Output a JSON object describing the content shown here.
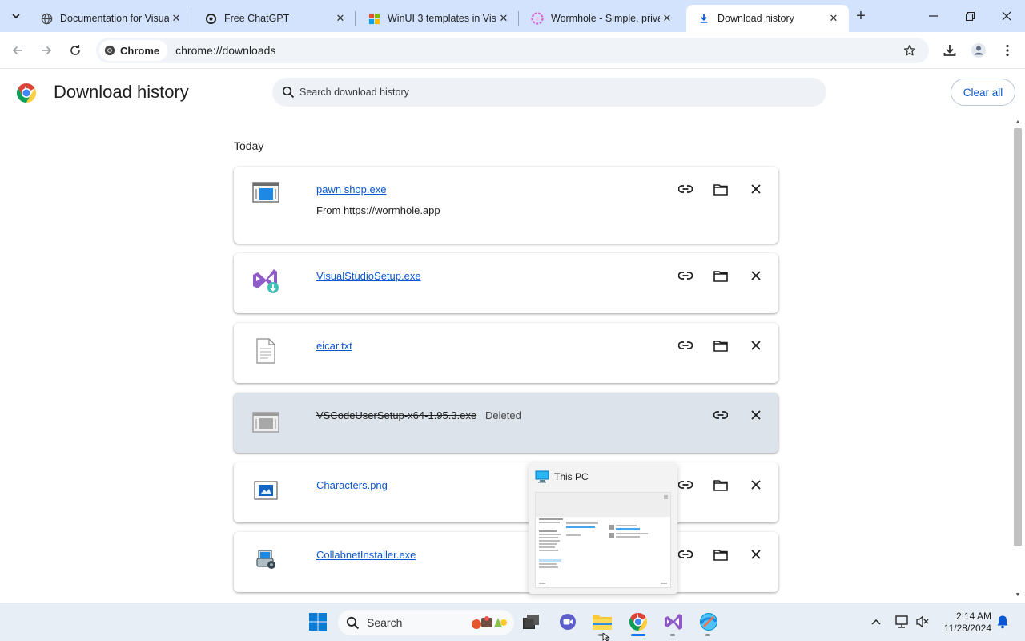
{
  "browser": {
    "tabs": [
      {
        "title": "Documentation for Visual",
        "favicon": "globe-icon",
        "active": false
      },
      {
        "title": "Free ChatGPT",
        "favicon": "openai-icon",
        "active": false
      },
      {
        "title": "WinUI 3 templates in Visu",
        "favicon": "microsoft-icon",
        "active": false
      },
      {
        "title": "Wormhole - Simple, priva",
        "favicon": "wormhole-icon",
        "active": false
      },
      {
        "title": "Download history",
        "favicon": "download-icon",
        "active": true
      }
    ],
    "omnibox": {
      "chip": "Chrome",
      "url": "chrome://downloads"
    }
  },
  "page": {
    "title": "Download history",
    "search_placeholder": "Search download history",
    "clear_all": "Clear all",
    "section": "Today",
    "downloads": [
      {
        "name": "pawn shop.exe",
        "source": "From https://wormhole.app",
        "icon": "exe-window-icon"
      },
      {
        "name": "VisualStudioSetup.exe",
        "icon": "visual-studio-installer-icon"
      },
      {
        "name": "eicar.txt",
        "icon": "text-file-icon"
      },
      {
        "name": "VSCodeUserSetup-x64-1.95.3.exe",
        "status": "Deleted",
        "icon": "exe-window-icon"
      },
      {
        "name": "Characters.png",
        "icon": "image-file-icon"
      },
      {
        "name": "CollabnetInstaller.exe",
        "icon": "installer-icon"
      }
    ]
  },
  "thumbnail_popup": {
    "title": "This PC"
  },
  "taskbar": {
    "search_label": "Search",
    "time": "2:14 AM",
    "date": "11/28/2024"
  }
}
